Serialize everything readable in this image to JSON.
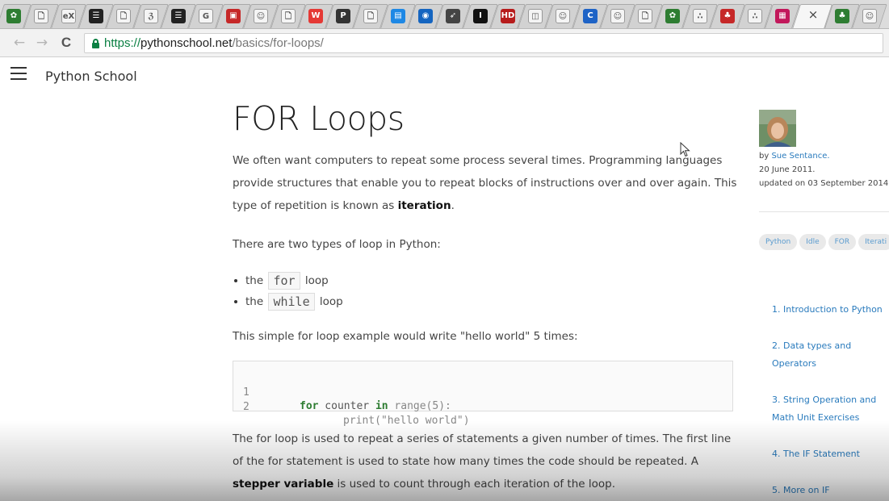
{
  "browser": {
    "tabs": [
      {
        "icon": "ghost-icon",
        "color": "#2e7d32",
        "glyph": "✿"
      },
      {
        "icon": "page-icon",
        "color": "#ffffff",
        "glyph": "🗋"
      },
      {
        "icon": "edx-icon",
        "color": "#ffffff",
        "glyph": "eX"
      },
      {
        "icon": "menu-icon",
        "color": "#222222",
        "glyph": "☰"
      },
      {
        "icon": "page-icon",
        "color": "#ffffff",
        "glyph": "🗋"
      },
      {
        "icon": "ampersand-icon",
        "color": "#ffffff",
        "glyph": "ℨ"
      },
      {
        "icon": "menu-icon",
        "color": "#222222",
        "glyph": "☰"
      },
      {
        "icon": "g-icon",
        "color": "#ffffff",
        "glyph": "G"
      },
      {
        "icon": "picture-icon",
        "color": "#c62828",
        "glyph": "▣"
      },
      {
        "icon": "reddit-icon",
        "color": "#ffffff",
        "glyph": "☺"
      },
      {
        "icon": "page-icon",
        "color": "#ffffff",
        "glyph": "🗋"
      },
      {
        "icon": "wordpress-icon",
        "color": "#e53935",
        "glyph": "W"
      },
      {
        "icon": "psy-icon",
        "color": "#333333",
        "glyph": "P"
      },
      {
        "icon": "page-icon",
        "color": "#ffffff",
        "glyph": "🗋"
      },
      {
        "icon": "window-icon",
        "color": "#1e88e5",
        "glyph": "▤"
      },
      {
        "icon": "globe-icon",
        "color": "#1565c0",
        "glyph": "◉"
      },
      {
        "icon": "rocket-icon",
        "color": "#444444",
        "glyph": "➶"
      },
      {
        "icon": "bold-i-icon",
        "color": "#111111",
        "glyph": "I"
      },
      {
        "icon": "hd-icon",
        "color": "#b71c1c",
        "glyph": "HD"
      },
      {
        "icon": "image-icon",
        "color": "#ffffff",
        "glyph": "◫"
      },
      {
        "icon": "reddit-icon",
        "color": "#ffffff",
        "glyph": "☺"
      },
      {
        "icon": "c-icon",
        "color": "#1e63c6",
        "glyph": "C"
      },
      {
        "icon": "reddit-icon",
        "color": "#ffffff",
        "glyph": "☺"
      },
      {
        "icon": "page-icon",
        "color": "#ffffff",
        "glyph": "🗋"
      },
      {
        "icon": "ghost-icon",
        "color": "#2e7d32",
        "glyph": "✿"
      },
      {
        "icon": "dots-icon",
        "color": "#ffffff",
        "glyph": "∴"
      },
      {
        "icon": "tree-icon",
        "color": "#c62828",
        "glyph": "♣"
      },
      {
        "icon": "dots-icon",
        "color": "#ffffff",
        "glyph": "∴"
      },
      {
        "icon": "red-square-icon",
        "color": "#c2185b",
        "glyph": "▦"
      },
      {
        "icon": "close-tab-icon",
        "color": "#f6f6f6",
        "glyph": "×"
      },
      {
        "icon": "green-tree-icon",
        "color": "#2e7d32",
        "glyph": "♣"
      },
      {
        "icon": "reddit-icon",
        "color": "#ffffff",
        "glyph": "☺"
      }
    ],
    "close_glyph": "×",
    "back_glyph": "←",
    "forward_glyph": "→",
    "reload_glyph": "C",
    "url": {
      "scheme": "https://",
      "host": "pythonschool.net",
      "path": "/basics/for-loops/"
    }
  },
  "site": {
    "name": "Python School"
  },
  "article": {
    "title": "FOR Loops",
    "intro": {
      "before": "We often want computers to repeat some process several times. Programming languages provide structures that enable you to repeat blocks of instructions over and over again. This type of repetition is known as ",
      "bold": "iteration",
      "after": "."
    },
    "types_intro": "There are two types of loop in Python:",
    "bullets": [
      {
        "prefix": "the",
        "code": "for",
        "suffix": "loop"
      },
      {
        "prefix": "the",
        "code": "while",
        "suffix": "loop"
      }
    ],
    "example_intro": "This simple for loop example would write \"hello world\" 5 times:",
    "code_lines": [
      {
        "num": "1",
        "indent": "",
        "kw1": "for",
        "t1": " counter ",
        "kw2": "in",
        "t2": " ",
        "fn": "range(5):"
      },
      {
        "num": "2",
        "indent": "    ",
        "kw1": "",
        "t1": "",
        "kw2": "",
        "t2": "",
        "fn": "print(\"hello world\")"
      }
    ],
    "explanation": {
      "before": "The for loop is used to repeat a series of statements a given number of times. The first line of the for statement is used to state how many times the code should be repeated. A ",
      "bold": "stepper variable",
      "after": " is used to count through each iteration of the loop."
    }
  },
  "sidebar": {
    "by": "by ",
    "author": "Sue Sentance.",
    "date": "20 June 2011.",
    "updated": "updated on 03 September 2014.",
    "tags": [
      "Python",
      "Idle",
      "FOR",
      "Iterati"
    ],
    "toc": [
      "1. Introduction to Python",
      "2. Data types and Operators",
      "3. String Operation and Math Unit Exercises",
      "4. The IF Statement",
      "5. More on IF"
    ]
  }
}
